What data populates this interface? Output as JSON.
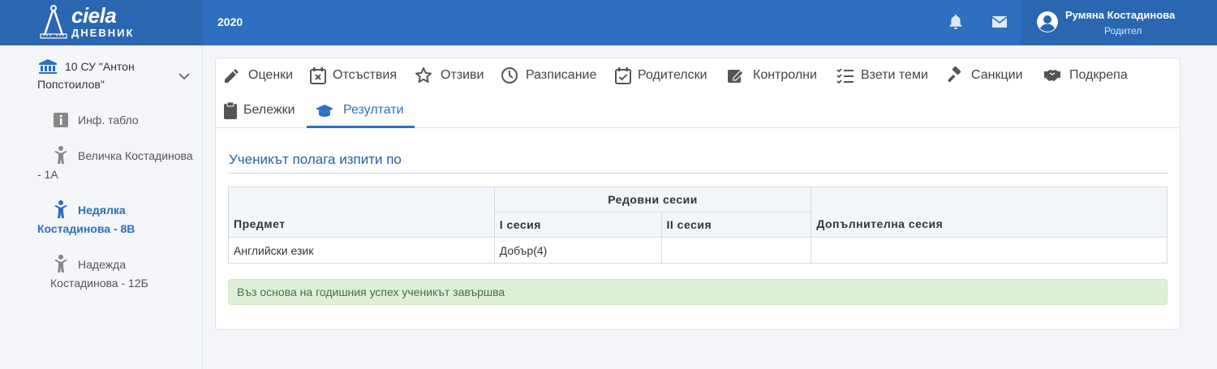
{
  "header": {
    "logo_text": "ciela",
    "logo_subtext": "ДНЕВНИК",
    "year": "2020",
    "user_name": "Румяна Костадинова",
    "user_role": "Родител",
    "accent": "#2e6fc0"
  },
  "sidebar": {
    "school": "10 СУ \"Антон Попстоилов\"",
    "items": [
      {
        "label": "Инф. табло",
        "icon": "info-icon"
      },
      {
        "label": "Величка Костадинова - 1А",
        "icon": "child-icon"
      },
      {
        "label": "Недялка Костадинова - 8В",
        "icon": "child-icon",
        "active": true
      },
      {
        "label": "Надежда Костадинова - 12Б",
        "icon": "child-icon"
      }
    ]
  },
  "tabs": [
    {
      "label": "Оценки",
      "icon": "pencil-icon"
    },
    {
      "label": "Отсъствия",
      "icon": "calendar-x-icon"
    },
    {
      "label": "Отзиви",
      "icon": "star-icon"
    },
    {
      "label": "Разписание",
      "icon": "clock-icon"
    },
    {
      "label": "Родителски",
      "icon": "calendar-check-icon"
    },
    {
      "label": "Контролни",
      "icon": "edit-icon"
    },
    {
      "label": "Взети теми",
      "icon": "checklist-icon"
    },
    {
      "label": "Санкции",
      "icon": "gavel-icon"
    },
    {
      "label": "Подкрепа",
      "icon": "handshake-icon"
    },
    {
      "label": "Бележки",
      "icon": "clipboard-icon"
    },
    {
      "label": "Резултати",
      "icon": "graduation-cap-icon",
      "active": true
    }
  ],
  "main": {
    "title": "Ученикът полага изпити по",
    "table": {
      "col_subject": "Предмет",
      "col_regular": "Редовни сесии",
      "col_session1": "I сесия",
      "col_session2": "II сесия",
      "col_extra": "Допълнителна сесия",
      "rows": [
        {
          "subject": "Английски език",
          "session1": "Добър(4)",
          "session2": "",
          "extra": ""
        }
      ]
    },
    "alert": "Въз основа на годишния успех ученикът завършва"
  }
}
